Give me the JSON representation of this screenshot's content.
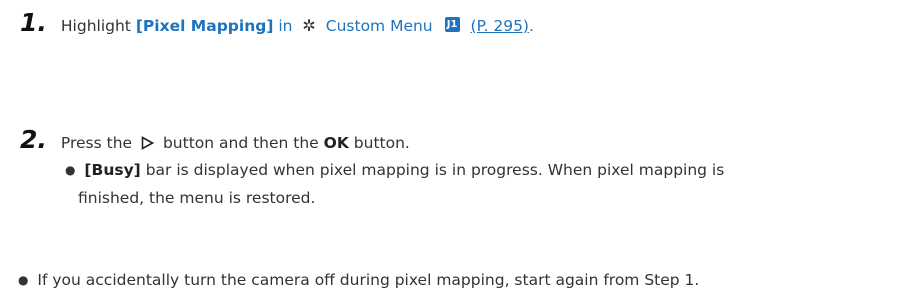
{
  "step1": {
    "number": "1.",
    "text_highlight": "Highlight",
    "bracket_item": "[Pixel Mapping]",
    "in_word": "in",
    "gear_icon": "gear-icon",
    "custom_menu": "Custom Menu",
    "menu_badge": "J1",
    "page_ref": "(P. 295)",
    "period": ".",
    "colors": {
      "link": "#1e73be"
    }
  },
  "step2": {
    "number": "2.",
    "text_press": "Press the",
    "triangle_icon": "right-triangle-icon",
    "text_button_then": "button and then the",
    "ok": "OK",
    "text_button_end": "button.",
    "bullet": {
      "busy": "[Busy]",
      "line1_rest": "bar is displayed when pixel mapping is in progress. When pixel mapping is",
      "line2": "finished, the menu is restored."
    }
  },
  "note": {
    "text": "If you accidentally turn the camera off during pixel mapping, start again from Step 1."
  }
}
